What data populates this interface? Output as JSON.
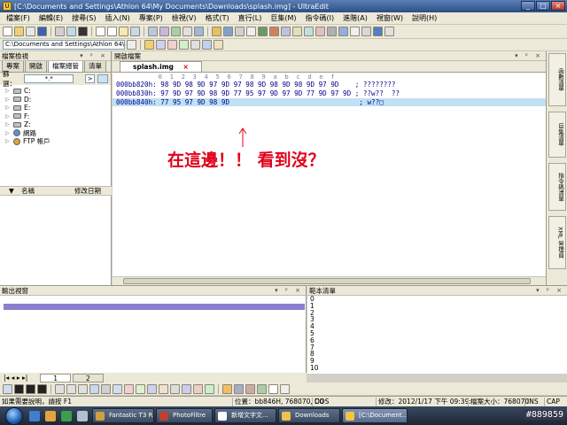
{
  "window": {
    "title": "[C:\\Documents and Settings\\Athlon 64\\My Documents\\Downloads\\splash.img] - UltraEdit",
    "controls": [
      "_",
      "□",
      "×"
    ]
  },
  "menu": {
    "items": [
      "檔案(F)",
      "編輯(E)",
      "搜尋(S)",
      "插入(N)",
      "專案(P)",
      "檢視(V)",
      "格式(T)",
      "直行(L)",
      "巨集(M)",
      "指令碼(I)",
      "進階(A)",
      "視窗(W)",
      "說明(H)"
    ]
  },
  "toolbar2": {
    "path": "C:\\Documents and Settings\\Athlon 64\\"
  },
  "left_panel": {
    "title": "檔案檢視",
    "tabs": [
      "專案",
      "開啟",
      "檔案總管",
      "清單"
    ],
    "filter_label": "篩選：",
    "filter_value": "*.*",
    "filter_go": ">",
    "tree": [
      {
        "label": "C:",
        "icon": "drive-icon"
      },
      {
        "label": "D:",
        "icon": "drive-icon"
      },
      {
        "label": "E:",
        "icon": "drive-icon"
      },
      {
        "label": "F:",
        "icon": "drive-icon"
      },
      {
        "label": "Z:",
        "icon": "drive-icon"
      },
      {
        "label": "網路",
        "icon": "network-icon"
      },
      {
        "label": "FTP 帳戶",
        "icon": "ftp-icon"
      }
    ],
    "list_headers": [
      "名稱",
      "修改日期"
    ]
  },
  "editor": {
    "panel_title": "開啟檔案",
    "tab_label": "splash.img",
    "ruler": "           0  1  2  3  4  5  6  7  8  9  a  b  c  d  e  f",
    "rows": [
      {
        "address": "000bb820h:",
        "bytes": "98 9D 98 9D 97 9D 97 98 9D 98 9D 98 9D 97 9D",
        "ascii": "; ????????"
      },
      {
        "address": "000bb830h:",
        "bytes": "97 9D 97 9D 98 9D 77 95 97 9D 97 9D 77 9D 97 9D",
        "ascii": "; ??w??  ??"
      },
      {
        "address": "000bb840h:",
        "bytes": "77 95 97 9D 98 9D",
        "ascii": "; w??□"
      }
    ],
    "annotation": "在這邊！！ 看到沒？"
  },
  "right_dock": {
    "tabs": [
      "函數清單",
      "巨集清單",
      "指令碼清單",
      "XML 管理員"
    ]
  },
  "output_panel": {
    "title": "輸出視窗"
  },
  "template_panel": {
    "title": "範本清單",
    "items": [
      "0",
      "1",
      "2",
      "3",
      "4",
      "5",
      "6",
      "7",
      "8",
      "9",
      "10"
    ]
  },
  "bottom_tabs": [
    "1",
    "2"
  ],
  "status": {
    "help": "如果需要說明，請按 F1",
    "position": "位置：bb846H, 768070, C0",
    "format": "DOS",
    "modified": "修改：2012/1/17 下午 09:39:",
    "filesize": "檔案大小：768070",
    "mode": "INS",
    "col": "CAP"
  },
  "taskbar": {
    "tasks": [
      "Fantastic T3 R...",
      "PhotoFiltre",
      "新增文字文...",
      "Downloads",
      "[C:\\Document..."
    ],
    "watermark": "#889859"
  }
}
